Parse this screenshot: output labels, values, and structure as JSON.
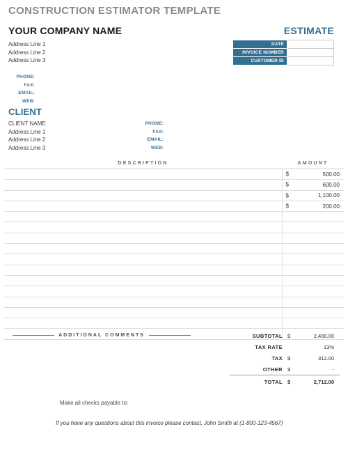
{
  "document": {
    "title": "CONSTRUCTION ESTIMATOR TEMPLATE",
    "estimate_heading": "ESTIMATE"
  },
  "company": {
    "name": "YOUR COMPANY NAME",
    "address": [
      "Address Line 1",
      "Address Line 2",
      "Address Line 3"
    ],
    "contacts": [
      {
        "label": "PHONE:",
        "value": ""
      },
      {
        "label": "FAX:",
        "value": ""
      },
      {
        "label": "EMAIL:",
        "value": ""
      },
      {
        "label": "WEB:",
        "value": ""
      }
    ]
  },
  "meta": {
    "rows": [
      {
        "label": "DATE",
        "value": ""
      },
      {
        "label": "INVOICE NUMBER",
        "value": ""
      },
      {
        "label": "CUSTOMER ID",
        "value": ""
      }
    ]
  },
  "client": {
    "heading": "CLIENT",
    "name": "CLIENT NAME",
    "address": [
      "Address Line 1",
      "Address Line 2",
      "Address Line 3"
    ],
    "contacts": [
      {
        "label": "PHONE:",
        "value": ""
      },
      {
        "label": "FAX:",
        "value": ""
      },
      {
        "label": "EMAIL:",
        "value": ""
      },
      {
        "label": "WEB:",
        "value": ""
      }
    ]
  },
  "line_items": {
    "headers": {
      "description": "DESCRIPTION",
      "amount": "AMOUNT"
    },
    "currency_symbol": "$",
    "rows": [
      {
        "description": "",
        "amount": "500.00"
      },
      {
        "description": "",
        "amount": "600.00"
      },
      {
        "description": "",
        "amount": "1,100.00"
      },
      {
        "description": "",
        "amount": "200.00"
      },
      {
        "description": "",
        "amount": ""
      },
      {
        "description": "",
        "amount": ""
      },
      {
        "description": "",
        "amount": ""
      },
      {
        "description": "",
        "amount": ""
      },
      {
        "description": "",
        "amount": ""
      },
      {
        "description": "",
        "amount": ""
      },
      {
        "description": "",
        "amount": ""
      },
      {
        "description": "",
        "amount": ""
      },
      {
        "description": "",
        "amount": ""
      },
      {
        "description": "",
        "amount": ""
      },
      {
        "description": "",
        "amount": ""
      },
      {
        "description": "",
        "amount": ""
      }
    ]
  },
  "comments": {
    "label": "ADDITIONAL COMMENTS"
  },
  "totals": {
    "rows": [
      {
        "label": "SUBTOTAL",
        "currency": "$",
        "value": "2,400.00"
      },
      {
        "label": "TAX RATE",
        "currency": "",
        "value": "13%"
      },
      {
        "label": "TAX",
        "currency": "$",
        "value": "312.00"
      },
      {
        "label": "OTHER",
        "currency": "$",
        "value": "-"
      }
    ],
    "total": {
      "label": "TOTAL",
      "currency": "$",
      "value": "2,712.00"
    }
  },
  "footer": {
    "pay_to": "Make all checks payable to:",
    "questions": "If you have any questions about this invoice please contact, John Smith at (1-800-123-4567)"
  },
  "colors": {
    "accent_blue": "#336f91",
    "title_gray": "#8a8a8a",
    "rule_gray": "#dcdcdc"
  }
}
